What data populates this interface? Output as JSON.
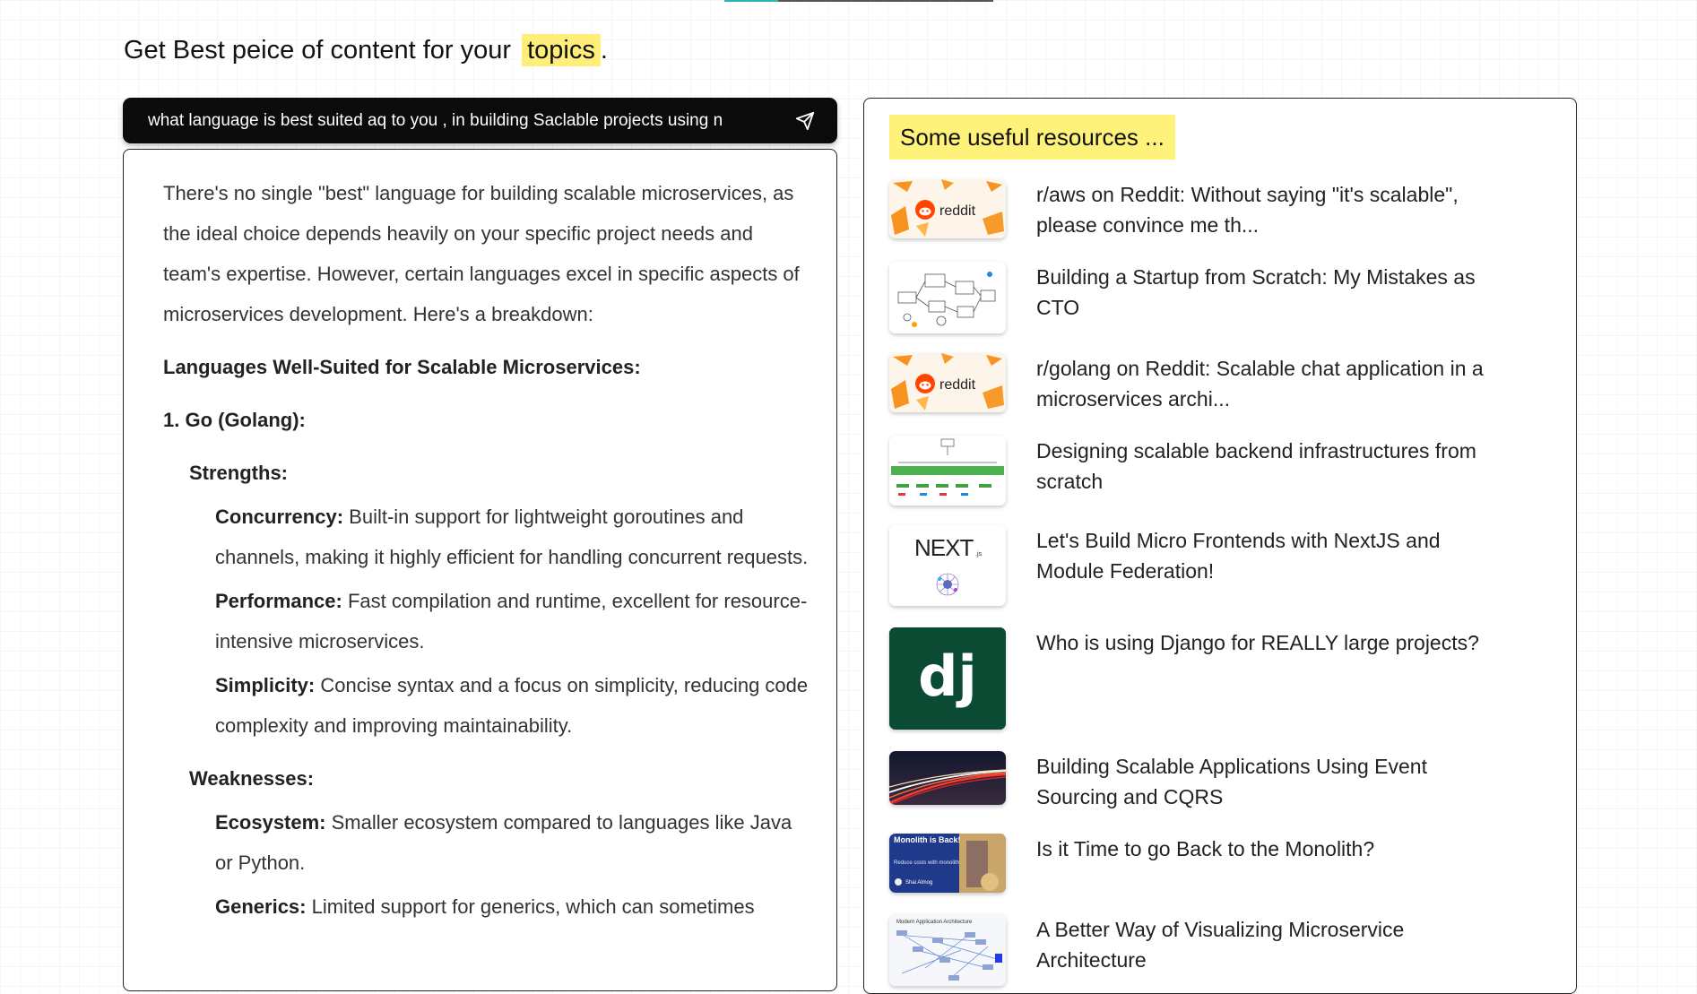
{
  "header": {
    "headline_prefix": "Get Best peice of content for your",
    "headline_highlight": "topics",
    "headline_suffix": "."
  },
  "query": {
    "value": "what language is best suited aq to you , in building Saclable projects using n"
  },
  "answer": {
    "intro": "There's no single \"best\" language for building scalable microservices, as the ideal choice depends heavily on your specific project needs and team's expertise. However, certain languages excel in specific aspects of microservices development. Here's a breakdown:",
    "section_title": "Languages Well-Suited for Scalable Microservices:",
    "item1_title": "1. Go (Golang):",
    "strengths_label": "Strengths:",
    "strengths": [
      {
        "term": "Concurrency:",
        "text": " Built-in support for lightweight goroutines and channels, making it highly efficient for handling concurrent requests."
      },
      {
        "term": "Performance:",
        "text": " Fast compilation and runtime, excellent for resource-intensive microservices."
      },
      {
        "term": "Simplicity:",
        "text": " Concise syntax and a focus on simplicity, reducing code complexity and improving maintainability."
      }
    ],
    "weaknesses_label": "Weaknesses:",
    "weaknesses": [
      {
        "term": "Ecosystem:",
        "text": " Smaller ecosystem compared to languages like Java or Python."
      },
      {
        "term": "Generics:",
        "text": " Limited support for generics, which can sometimes"
      }
    ]
  },
  "resources": {
    "title": "Some useful resources ...",
    "items": [
      {
        "title": "r/aws on Reddit: Without saying \"it's scalable\", please convince me th...",
        "thumb": "reddit-logo"
      },
      {
        "title": "Building a Startup from Scratch: My Mistakes as CTO",
        "thumb": "architecture-sketch"
      },
      {
        "title": "r/golang on Reddit: Scalable chat application in a microservices archi...",
        "thumb": "reddit-logo"
      },
      {
        "title": "Designing scalable backend infrastructures from scratch",
        "thumb": "green-flow-diagram"
      },
      {
        "title": "Let's Build Micro Frontends with NextJS and Module Federation!",
        "thumb": "nextjs-logo",
        "thumb_text": "NEXT",
        "thumb_sub": ".js"
      },
      {
        "title": "Who is using Django for REALLY large projects?",
        "thumb": "django-logo",
        "thumb_text": "dj"
      },
      {
        "title": "Building Scalable Applications Using Event Sourcing and CQRS",
        "thumb": "highway-light-trails"
      },
      {
        "title": "Is it Time to go Back to the Monolith?",
        "thumb": "monolith-banner",
        "thumb_text": "Monolith is Back!",
        "thumb_sub": "Reduce costs with monolith",
        "thumb_author": "Shai Almog"
      },
      {
        "title": "A Better Way of Visualizing Microservice Architecture",
        "thumb": "microservice-graph",
        "thumb_text": "Modern Application Architecture"
      }
    ]
  },
  "colors": {
    "highlight": "#ffef7a",
    "query_bar": "#0b0b0b",
    "reddit_orange": "#ff4500",
    "django_green": "#0c4b33"
  }
}
